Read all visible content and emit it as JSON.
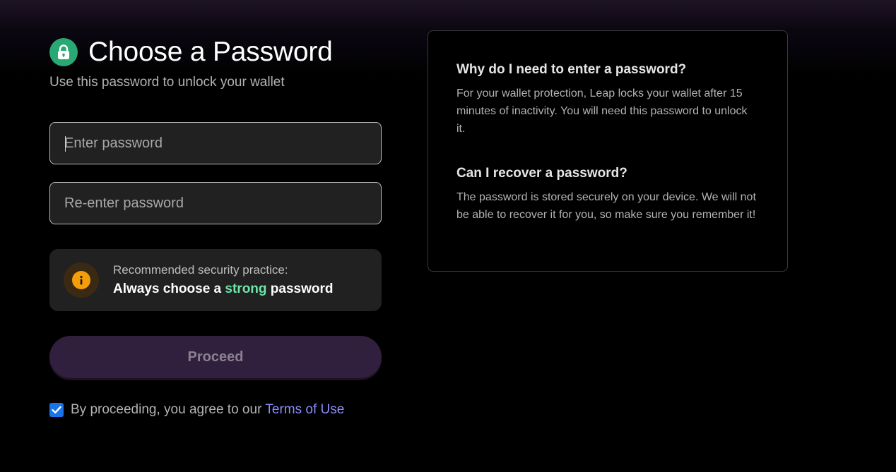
{
  "header": {
    "title": "Choose a Password",
    "subtitle": "Use this password to unlock your wallet",
    "icon": "lock-icon"
  },
  "form": {
    "password_placeholder": "Enter password",
    "password_value": "",
    "confirm_placeholder": "Re-enter password",
    "confirm_value": ""
  },
  "tip": {
    "icon": "info-icon",
    "caption": "Recommended security practice:",
    "main_prefix": "Always choose a ",
    "main_highlight": "strong",
    "main_suffix": " password"
  },
  "actions": {
    "proceed_label": "Proceed",
    "agree_checked": true,
    "agree_text": "By proceeding, you agree to our",
    "terms_link": "Terms of Use"
  },
  "faq": [
    {
      "question": "Why do I need to enter a password?",
      "answer": "For your wallet protection, Leap locks your wallet after 15 minutes of inactivity. You will need this password to unlock it."
    },
    {
      "question": "Can I recover a password?",
      "answer": "The password is stored securely on your device. We will not be able to recover it for you, so make sure you remember it!"
    }
  ],
  "colors": {
    "accent_green": "#29a874",
    "highlight_green": "#6ee7a8",
    "warning_orange": "#f59e0b",
    "button_purple": "#31203d",
    "link_blue": "#8c8cff",
    "checkbox_blue": "#1a73e8"
  }
}
